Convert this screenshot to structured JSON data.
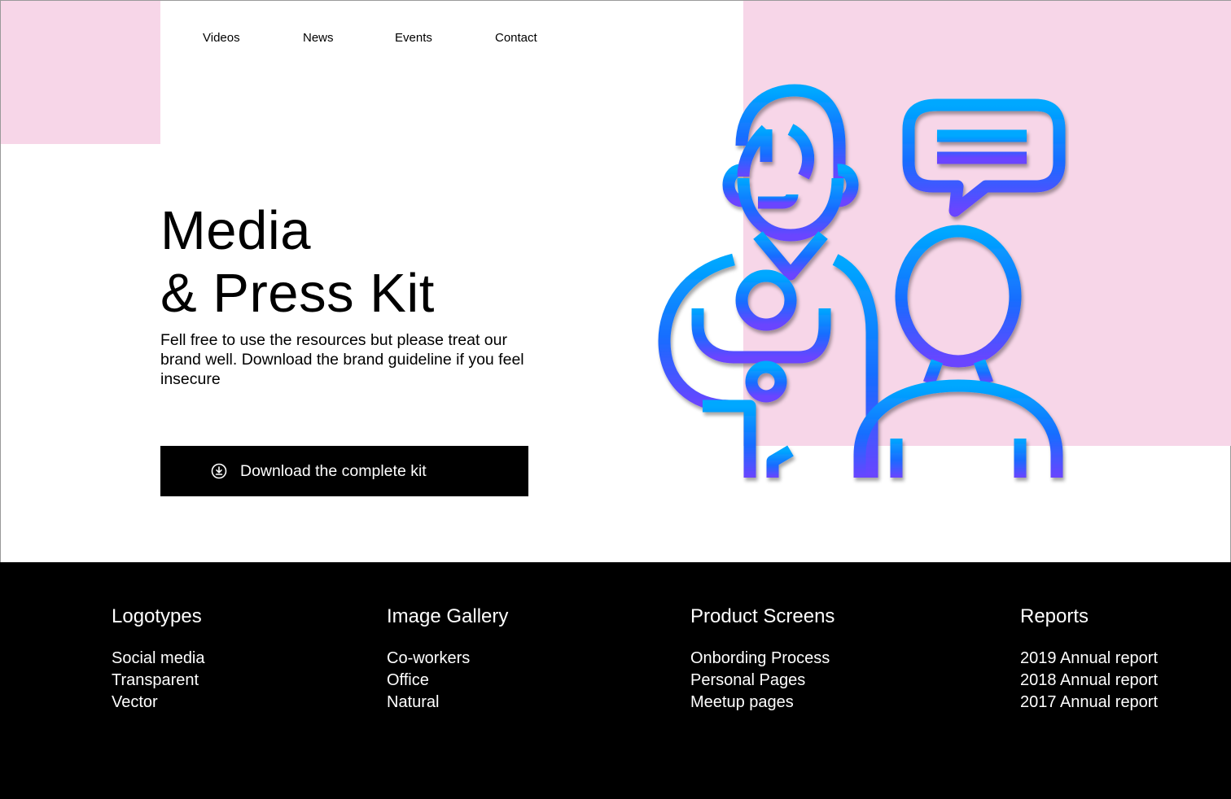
{
  "nav": {
    "items": [
      {
        "label": "Videos"
      },
      {
        "label": "News"
      },
      {
        "label": "Events"
      },
      {
        "label": "Contact"
      }
    ]
  },
  "hero": {
    "title_line1": "Media",
    "title_line2": "& Press Kit",
    "description": "Fell free to use the resources but please treat our brand well. Download the brand guideline if you feel insecure",
    "download_label": "Download the complete kit",
    "download_icon": "download-circle-icon",
    "illustration_icon": "press-interview-icon"
  },
  "colors": {
    "accent_pink": "#f7d6e8",
    "gradient_top": "#00a8ff",
    "gradient_mid": "#1a6bff",
    "gradient_bottom": "#6a44ff",
    "footer_bg": "#000000"
  },
  "footer": {
    "columns": [
      {
        "heading": "Logotypes",
        "links": [
          "Social media",
          "Transparent",
          "Vector"
        ]
      },
      {
        "heading": "Image Gallery",
        "links": [
          "Co-workers",
          "Office",
          "Natural"
        ]
      },
      {
        "heading": "Product Screens",
        "links": [
          "Onbording Process",
          "Personal Pages",
          "Meetup pages"
        ]
      },
      {
        "heading": "Reports",
        "links": [
          "2019 Annual report",
          "2018 Annual report",
          "2017 Annual report"
        ]
      }
    ]
  }
}
